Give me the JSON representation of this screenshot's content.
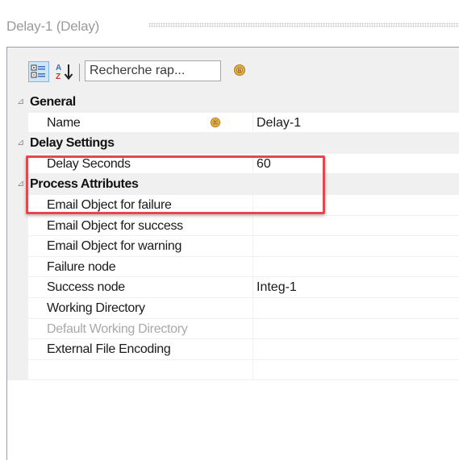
{
  "window": {
    "title": "Delay-1 (Delay)"
  },
  "toolbar": {
    "categorized_icon": "categorized-view-icon",
    "alphabetical_icon": "alphabetical-sort-icon",
    "search_placeholder": "Recherche rap...",
    "badge_icon": "property-pages-icon"
  },
  "categories": [
    {
      "label": "General",
      "collapse_glyph": "⊿",
      "rows": [
        {
          "name": "Name",
          "value": "Delay-1",
          "badge": true
        }
      ]
    },
    {
      "label": "Delay Settings",
      "collapse_glyph": "⊿",
      "rows": [
        {
          "name": "Delay Seconds",
          "value": "60"
        }
      ]
    },
    {
      "label": "Process Attributes",
      "collapse_glyph": "⊿",
      "rows": [
        {
          "name": "Email Object for failure",
          "value": ""
        },
        {
          "name": "Email Object for success",
          "value": ""
        },
        {
          "name": "Email Object for warning",
          "value": ""
        },
        {
          "name": "Failure node",
          "value": ""
        },
        {
          "name": "Success node",
          "value": "Integ-1"
        },
        {
          "name": "Working Directory",
          "value": ""
        },
        {
          "name": "Default Working Directory",
          "value": "",
          "disabled": true
        },
        {
          "name": "External File Encoding",
          "value": ""
        },
        {
          "name": "",
          "value": ""
        }
      ]
    }
  ],
  "colors": {
    "highlight": "#e4474d",
    "gutter": "#f0f0f0",
    "selected_button": "#cde6f7"
  }
}
